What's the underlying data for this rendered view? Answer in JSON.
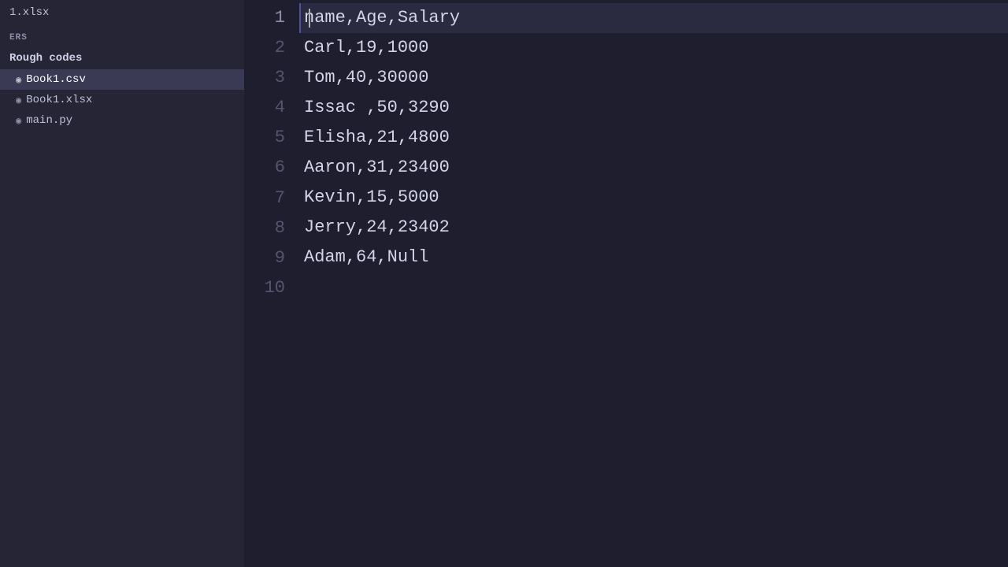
{
  "sidebar": {
    "top_file": "1.xlsx",
    "section_header": "ERS",
    "folder_label": "Rough codes",
    "items": [
      {
        "label": "Book1.csv",
        "icon": "📄",
        "active": true
      },
      {
        "label": "Book1.xlsx",
        "icon": "📊",
        "active": false
      },
      {
        "label": "main.py",
        "icon": "🐍",
        "active": false
      }
    ]
  },
  "editor": {
    "lines": [
      {
        "number": "1",
        "content": "name,Age,Salary",
        "active": true
      },
      {
        "number": "2",
        "content": "Carl,19,1000"
      },
      {
        "number": "3",
        "content": "Tom,40,30000"
      },
      {
        "number": "4",
        "content": "Issac ,50,3290"
      },
      {
        "number": "5",
        "content": "Elisha,21,4800"
      },
      {
        "number": "6",
        "content": "Aaron,31,23400"
      },
      {
        "number": "7",
        "content": "Kevin,15,5000"
      },
      {
        "number": "8",
        "content": "Jerry,24,23402"
      },
      {
        "number": "9",
        "content": "Adam,64,Null"
      },
      {
        "number": "10",
        "content": ""
      }
    ]
  }
}
